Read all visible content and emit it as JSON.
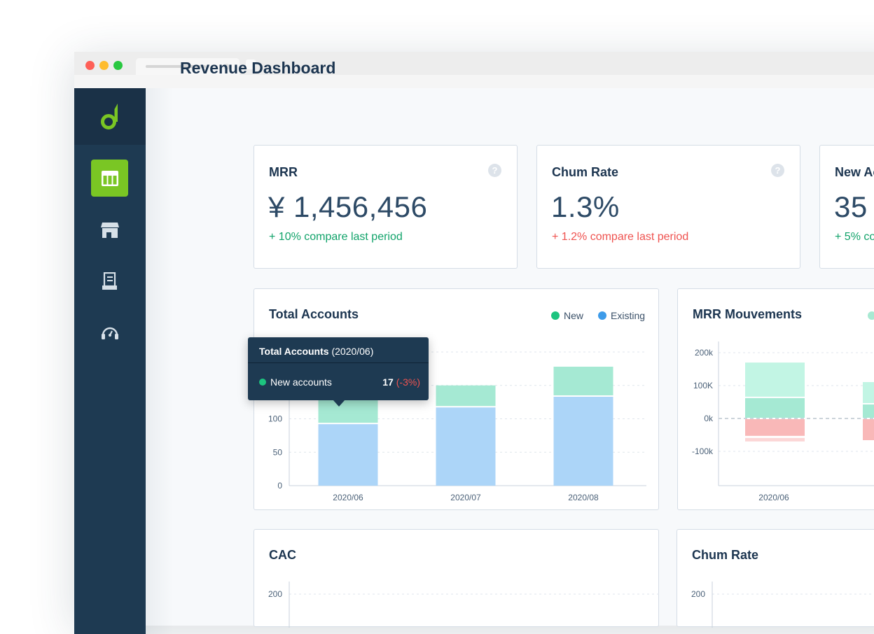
{
  "app": {
    "title": "Revenue Dashboard",
    "accent_color": "#7ac624",
    "sidebar_color": "#1e3a52"
  },
  "sidebar": {
    "logo": "d-logo-icon",
    "items": [
      {
        "icon": "table-icon",
        "active": true
      },
      {
        "icon": "store-icon",
        "active": false
      },
      {
        "icon": "receipt-icon",
        "active": false
      },
      {
        "icon": "support-headset-icon",
        "active": false
      }
    ]
  },
  "kpis": [
    {
      "label": "MRR",
      "value": "¥ 1,456,456",
      "delta": "+ 10% compare last period",
      "delta_color": "#11a36a"
    },
    {
      "label": "Chum Rate",
      "value": "1.3%",
      "delta": "+ 1.2% compare last period",
      "delta_color": "#ef5350"
    },
    {
      "label": "New Ac",
      "value": "35",
      "delta": "+ 5% co",
      "delta_color": "#11a36a"
    }
  ],
  "total_accounts": {
    "title": "Total Accounts",
    "legend": [
      {
        "label": "New",
        "color": "#1dc47f"
      },
      {
        "label": "Existing",
        "color": "#3d9be9"
      }
    ],
    "tooltip": {
      "title": "Total Accounts",
      "period": "(2020/06)",
      "row_label": "New accounts",
      "row_value": "17",
      "row_change": "(-3%)"
    }
  },
  "mrr_movements": {
    "title": "MRR Mouvements"
  },
  "cac": {
    "title": "CAC"
  },
  "churn": {
    "title": "Chum Rate"
  },
  "chart_data": [
    {
      "type": "bar",
      "title": "Total Accounts",
      "categories": [
        "2020/06",
        "2020/07",
        "2020/08"
      ],
      "series": [
        {
          "name": "Existing",
          "values": [
            92,
            117,
            133
          ]
        },
        {
          "name": "New",
          "values": [
            40,
            33,
            45
          ]
        }
      ],
      "stacked": true,
      "yticks": [
        0,
        50,
        100
      ],
      "ylim": [
        0,
        200
      ],
      "grid": true,
      "legend": "top-right"
    },
    {
      "type": "bar",
      "title": "MRR Mouvements",
      "categories": [
        "2020/06"
      ],
      "series": [
        {
          "values": [
            108000
          ]
        },
        {
          "values": [
            62000
          ]
        },
        {
          "values": [
            -55000
          ]
        },
        {
          "values": [
            -33000
          ]
        }
      ],
      "yticks": [
        "200k",
        "100K",
        "0k",
        "-100k"
      ],
      "ylim": [
        -200000,
        220000
      ],
      "grid": true
    },
    {
      "type": "line",
      "title": "CAC",
      "yticks": [
        200
      ]
    },
    {
      "type": "line",
      "title": "Chum Rate",
      "yticks": [
        200
      ]
    }
  ]
}
